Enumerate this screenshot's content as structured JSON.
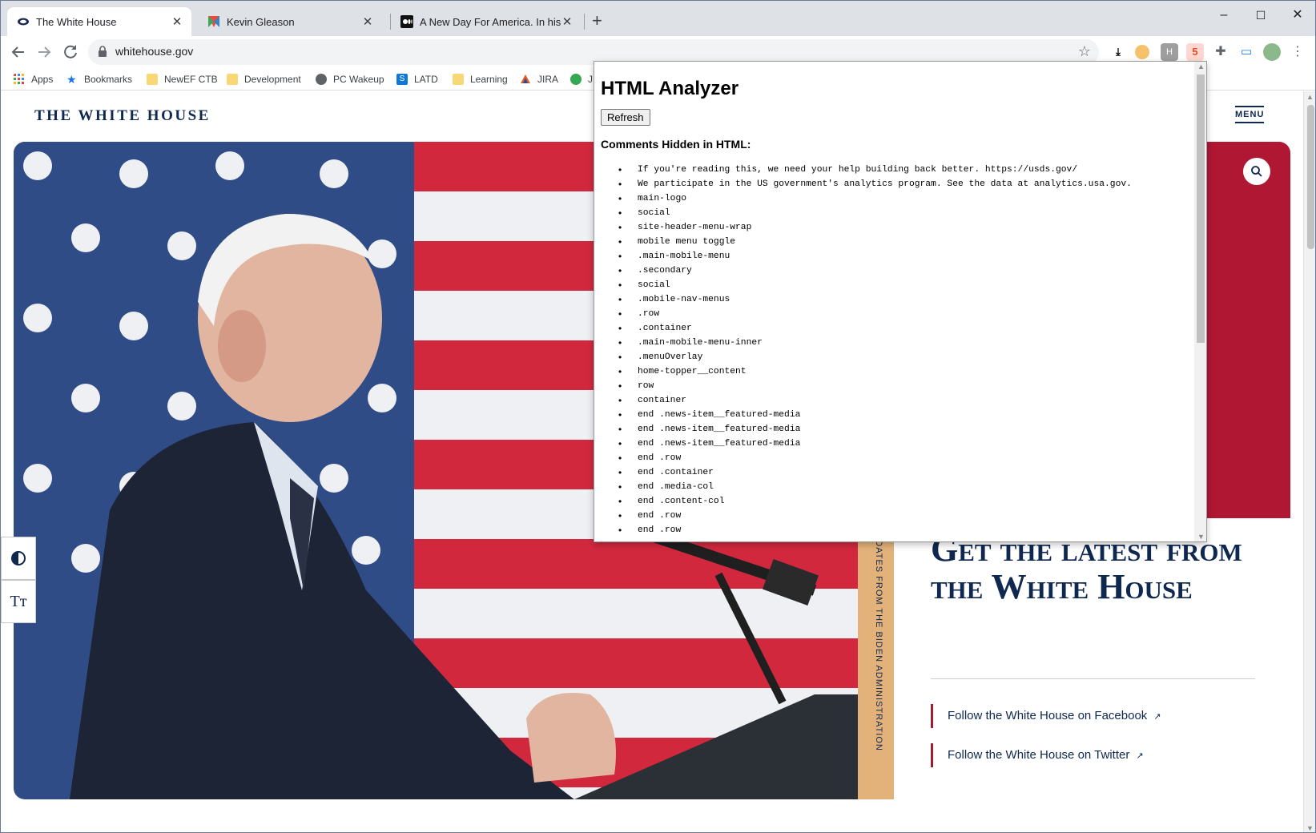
{
  "browser": {
    "tabs": [
      {
        "title": "The White House",
        "icon": "whitehouse-favicon",
        "active": true
      },
      {
        "title": "Kevin Gleason",
        "icon": "kevin-favicon",
        "active": false
      },
      {
        "title": "A New Day For America. In his in",
        "icon": "medium-favicon",
        "active": false
      }
    ],
    "new_tab": "+",
    "window_controls": {
      "minimize": "–",
      "maximize": "☐",
      "close": "✕"
    },
    "url": "whitehouse.gov",
    "bookmarks": [
      {
        "label": "Apps",
        "icon": "apps-grid-icon"
      },
      {
        "label": "Bookmarks",
        "icon": "star-icon"
      },
      {
        "label": "NewEF CTB",
        "icon": "folder-icon"
      },
      {
        "label": "Development",
        "icon": "folder-icon"
      },
      {
        "label": "PC Wakeup",
        "icon": "globe-icon"
      },
      {
        "label": "LATD",
        "icon": "sharepoint-icon"
      },
      {
        "label": "Learning",
        "icon": "folder-icon"
      },
      {
        "label": "JIRA",
        "icon": "jira-icon"
      },
      {
        "label": "J",
        "icon": "green-icon"
      }
    ]
  },
  "site": {
    "logo": "THE WHITE HOUSE",
    "menu_label": "MENU",
    "vertical_strip": "UPDATES FROM THE BIDEN ADMINISTRATION",
    "latest_heading": "Get the latest from the White House",
    "follow_links": [
      "Follow the White House on Facebook",
      "Follow the White House on Twitter"
    ],
    "link_arrow": "↗",
    "colors": {
      "navy": "#0f2850",
      "red": "#b01733",
      "accent": "#e3b27a"
    }
  },
  "popup": {
    "title": "HTML Analyzer",
    "refresh_label": "Refresh",
    "section_label": "Comments Hidden in HTML:",
    "comments": [
      "If you're reading this, we need your help building back better. https://usds.gov/",
      "We participate in the US government's analytics program. See the data at analytics.usa.gov.",
      "main-logo",
      "social",
      "site-header-menu-wrap",
      "mobile menu toggle",
      ".main-mobile-menu",
      ".secondary",
      "social",
      ".mobile-nav-menus",
      ".row",
      ".container",
      ".main-mobile-menu-inner",
      ".menuOverlay",
      "home-topper__content",
      "row",
      "container",
      "end .news-item__featured-media",
      "end .news-item__featured-media",
      "end .news-item__featured-media",
      "end .row",
      "end .container",
      "end .media-col",
      "end .content-col",
      "end .row",
      "end .row"
    ]
  }
}
